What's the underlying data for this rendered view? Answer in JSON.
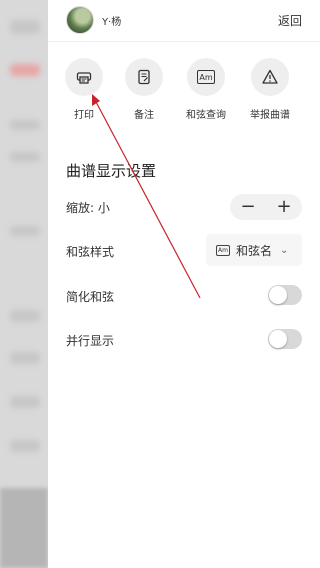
{
  "header": {
    "username": "Y·杨",
    "back_label": "返回"
  },
  "actions": [
    {
      "label": "打印",
      "icon": "printer-icon"
    },
    {
      "label": "备注",
      "icon": "note-icon"
    },
    {
      "label": "和弦查询",
      "icon": "chord-am-icon",
      "icon_text": "Am"
    },
    {
      "label": "举报曲谱",
      "icon": "warning-icon"
    }
  ],
  "settings": {
    "title": "曲谱显示设置",
    "zoom": {
      "label": "缩放: 小",
      "minus": "−",
      "plus": "+"
    },
    "chord_style": {
      "label": "和弦样式",
      "icon_text": "Am",
      "value": "和弦名",
      "chevron": "⌄"
    },
    "simplify": {
      "label": "简化和弦",
      "on": false
    },
    "parallel": {
      "label": "并行显示",
      "on": false
    }
  },
  "annotation": {
    "color": "#c8242c"
  }
}
